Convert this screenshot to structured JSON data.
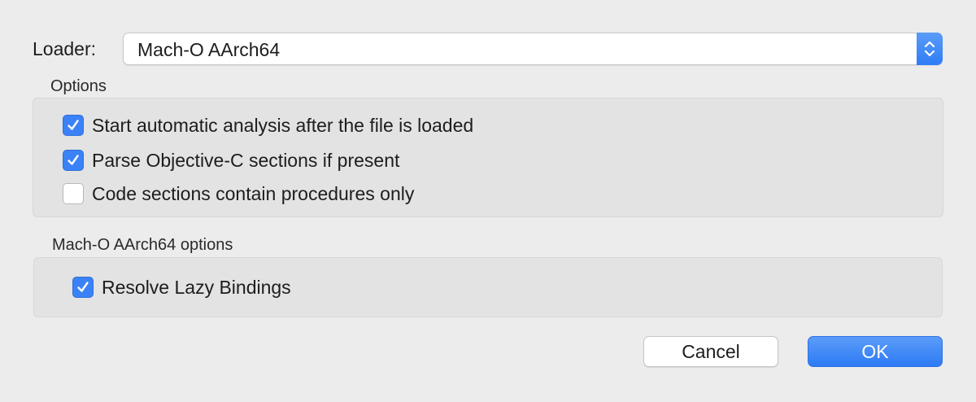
{
  "loader": {
    "label": "Loader:",
    "selected": "Mach-O AArch64",
    "stepper_icon": "up-down-chevron-icon"
  },
  "options": {
    "title": "Options",
    "items": [
      {
        "label": "Start automatic analysis after the file is loaded",
        "checked": true
      },
      {
        "label": "Parse Objective-C sections if present",
        "checked": true
      },
      {
        "label": "Code sections contain procedures only",
        "checked": false
      }
    ]
  },
  "macho_options": {
    "title": "Mach-O AArch64 options",
    "items": [
      {
        "label": "Resolve Lazy Bindings",
        "checked": true
      }
    ]
  },
  "buttons": {
    "cancel": "Cancel",
    "ok": "OK"
  },
  "colors": {
    "accent": "#3b82f6",
    "background": "#ececec",
    "group_background": "#e3e3e3"
  }
}
